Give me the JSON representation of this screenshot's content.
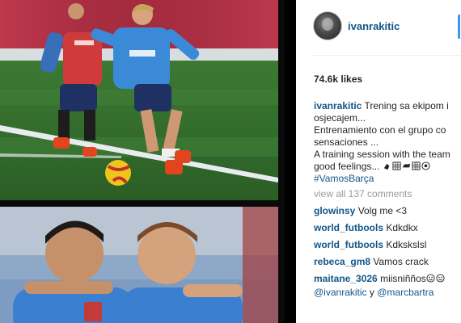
{
  "post": {
    "username": "ivanrakitic",
    "likes": "74.6k likes",
    "caption": {
      "user": "ivanrakitic",
      "line1": "Trening sa ekipom i",
      "line2": "osjecajem...",
      "line3": "Entrenamiento con el grupo co",
      "line4": "sensaciones ...",
      "line5": "A training session with the team",
      "line6": "good feelings...",
      "hashtag": "#VamosBarça"
    },
    "view_all": "view all 137 comments",
    "comments": [
      {
        "user": "glowinsy",
        "text": "Volg me <3"
      },
      {
        "user": "world_futbools",
        "text": "Kdkdkx"
      },
      {
        "user": "world_futbools",
        "text": "Kdkskslsl"
      },
      {
        "user": "rebeca_gm8",
        "text": "Vamos crack"
      },
      {
        "user": "maitane_3026",
        "text": "miisniñños"
      },
      {
        "user": "@ivanrakitic",
        "text": "y",
        "mention2": "@marcbartra"
      }
    ]
  },
  "icons": [
    "avatar",
    "emoji-hand-icon",
    "emoji-grid-icon",
    "emoji-flex-icon",
    "soccer-ball-icon",
    "smiley-icon"
  ],
  "colors": {
    "username": "#125688",
    "text": "#262626",
    "muted": "#999999",
    "accent": "#3897f0"
  }
}
